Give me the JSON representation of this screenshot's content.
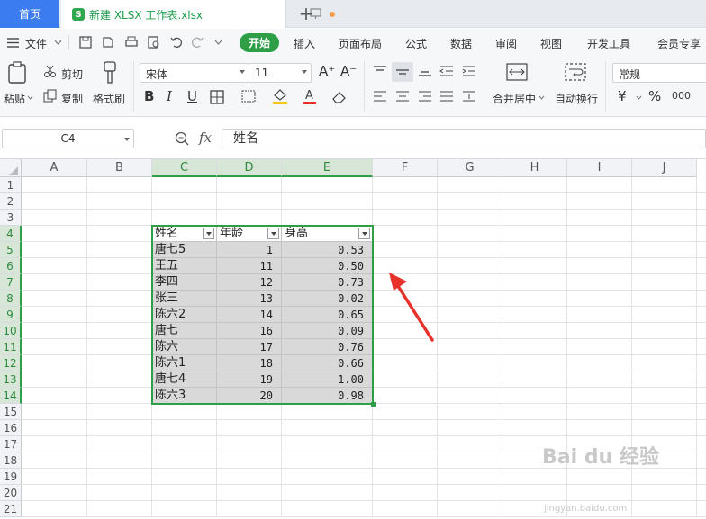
{
  "tabs": {
    "home": "首页",
    "doc_icon": "S",
    "doc_title": "新建 XLSX 工作表.xlsx",
    "add": "+"
  },
  "menu": {
    "file": "文件",
    "items": [
      "开始",
      "插入",
      "页面布局",
      "公式",
      "数据",
      "审阅",
      "视图",
      "开发工具",
      "会员专享"
    ]
  },
  "ribbon": {
    "paste": "粘贴",
    "cut": "剪切",
    "copy": "复制",
    "format_painter": "格式刷",
    "font_name": "宋体",
    "font_size": "11",
    "merge_center": "合并居中",
    "wrap_text": "自动换行",
    "number_format": "常规",
    "currency": "¥",
    "percent": "%",
    "thousands": "000",
    "increase_font": "A⁺",
    "decrease_font": "A⁻"
  },
  "formula_bar": {
    "name_box": "C4",
    "fx": "fx",
    "content": "姓名"
  },
  "columns": [
    "A",
    "B",
    "C",
    "D",
    "E",
    "F",
    "G",
    "H",
    "I",
    "J"
  ],
  "selected_columns": [
    "C",
    "D",
    "E"
  ],
  "rows": [
    "1",
    "2",
    "3",
    "4",
    "5",
    "6",
    "7",
    "8",
    "9",
    "10",
    "11",
    "12",
    "13",
    "14",
    "15",
    "16",
    "17",
    "18",
    "19",
    "20",
    "21"
  ],
  "selected_rows": [
    "4",
    "5",
    "6",
    "7",
    "8",
    "9",
    "10",
    "11",
    "12",
    "13",
    "14"
  ],
  "table": {
    "headers": [
      "姓名",
      "年龄",
      "身高"
    ],
    "rows": [
      [
        "唐七5",
        "1",
        "0.53"
      ],
      [
        "王五",
        "11",
        "0.50"
      ],
      [
        "李四",
        "12",
        "0.73"
      ],
      [
        "张三",
        "13",
        "0.02"
      ],
      [
        "陈六2",
        "14",
        "0.65"
      ],
      [
        "唐七",
        "16",
        "0.09"
      ],
      [
        "陈六",
        "17",
        "0.76"
      ],
      [
        "陈六1",
        "18",
        "0.66"
      ],
      [
        "唐七4",
        "19",
        "1.00"
      ],
      [
        "陈六3",
        "20",
        "0.98"
      ]
    ]
  },
  "watermark": {
    "main": "Bai du 经验",
    "sub": "jingyan.baidu.com"
  },
  "colors": {
    "accent_green": "#2e9e47",
    "tab_blue": "#3b7cf0",
    "arrow_red": "#e8312a",
    "range_fill": "#d9d9d9"
  }
}
